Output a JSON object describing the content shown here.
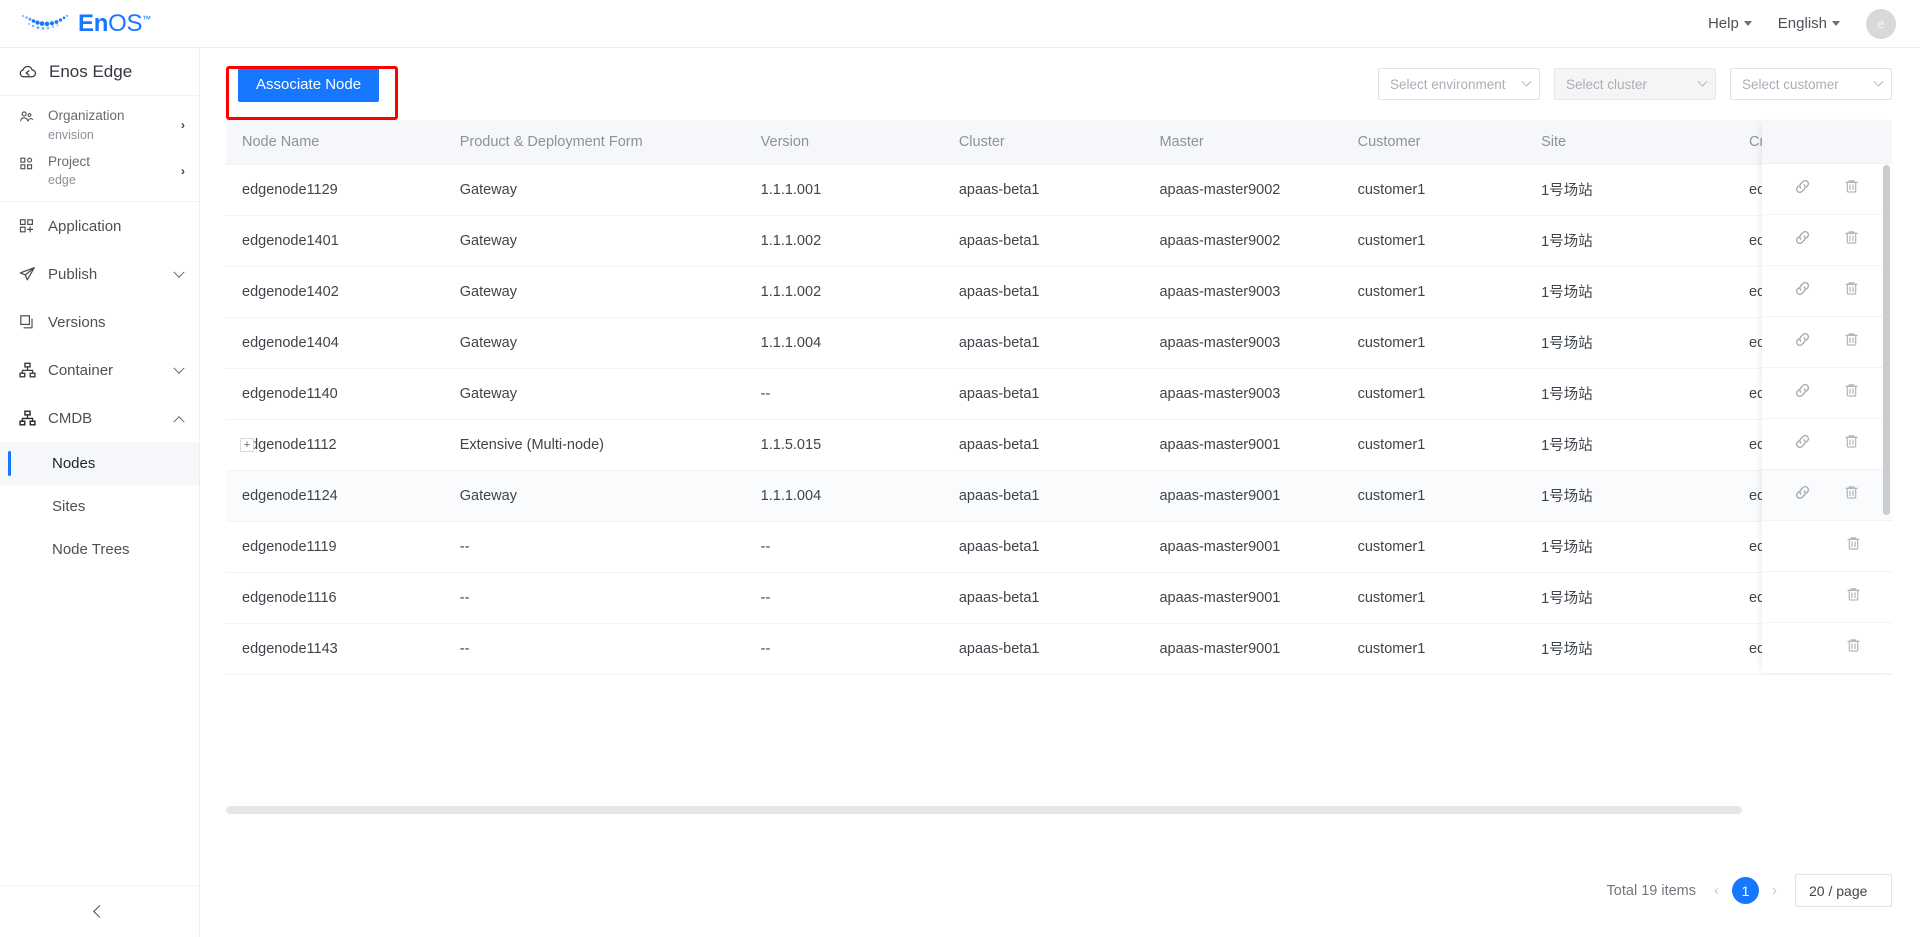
{
  "topbar": {
    "brand_en": "En",
    "brand_os": "OS",
    "brand_tm": "™",
    "help_label": "Help",
    "language_label": "English",
    "avatar_letter": "e"
  },
  "sidebar": {
    "title": "Enos Edge",
    "context": [
      {
        "label": "Organization",
        "value": "envision",
        "icon": "organization-icon"
      },
      {
        "label": "Project",
        "value": "edge",
        "icon": "project-icon"
      }
    ],
    "nav": [
      {
        "label": "Application",
        "icon": "application-icon",
        "expandable": false
      },
      {
        "label": "Publish",
        "icon": "publish-icon",
        "expandable": true,
        "expanded": false
      },
      {
        "label": "Versions",
        "icon": "versions-icon",
        "expandable": false
      },
      {
        "label": "Container",
        "icon": "container-icon",
        "expandable": true,
        "expanded": false
      },
      {
        "label": "CMDB",
        "icon": "cmdb-icon",
        "expandable": true,
        "expanded": true
      }
    ],
    "cmdb_children": [
      {
        "label": "Nodes",
        "active": true
      },
      {
        "label": "Sites",
        "active": false
      },
      {
        "label": "Node Trees",
        "active": false
      }
    ],
    "collapse_icon": "chevron-left-icon"
  },
  "toolbar": {
    "associate_node_label": "Associate Node",
    "highlight_color": "#ff0000",
    "primary_color": "#1677ff",
    "filters": [
      {
        "placeholder": "Select environment",
        "disabled": false,
        "name": "environment"
      },
      {
        "placeholder": "Select cluster",
        "disabled": true,
        "name": "cluster"
      },
      {
        "placeholder": "Select customer",
        "disabled": false,
        "name": "customer"
      }
    ]
  },
  "table": {
    "columns": [
      "Node Name",
      "Product & Deployment Form",
      "Version",
      "Cluster",
      "Master",
      "Customer",
      "Site",
      "Crea",
      ""
    ],
    "rows": [
      {
        "node": "edgenode1129",
        "product": "Gateway",
        "version": "1.1.1.001",
        "cluster": "apaas-beta1",
        "master": "apaas-master9002",
        "customer": "customer1",
        "site": "1号场站",
        "created": "edg",
        "expandable": false,
        "hovered": false,
        "actions": [
          "unlink-icon",
          "delete-icon"
        ]
      },
      {
        "node": "edgenode1401",
        "product": "Gateway",
        "version": "1.1.1.002",
        "cluster": "apaas-beta1",
        "master": "apaas-master9002",
        "customer": "customer1",
        "site": "1号场站",
        "created": "edg",
        "expandable": false,
        "hovered": false,
        "actions": [
          "unlink-icon",
          "delete-icon"
        ]
      },
      {
        "node": "edgenode1402",
        "product": "Gateway",
        "version": "1.1.1.002",
        "cluster": "apaas-beta1",
        "master": "apaas-master9003",
        "customer": "customer1",
        "site": "1号场站",
        "created": "edg",
        "expandable": false,
        "hovered": false,
        "actions": [
          "unlink-icon",
          "delete-icon"
        ]
      },
      {
        "node": "edgenode1404",
        "product": "Gateway",
        "version": "1.1.1.004",
        "cluster": "apaas-beta1",
        "master": "apaas-master9003",
        "customer": "customer1",
        "site": "1号场站",
        "created": "edg",
        "expandable": false,
        "hovered": false,
        "actions": [
          "unlink-icon",
          "delete-icon"
        ]
      },
      {
        "node": "edgenode1140",
        "product": "Gateway",
        "version": "--",
        "cluster": "apaas-beta1",
        "master": "apaas-master9003",
        "customer": "customer1",
        "site": "1号场站",
        "created": "edg",
        "expandable": false,
        "hovered": false,
        "actions": [
          "unlink-icon",
          "delete-icon"
        ]
      },
      {
        "node": "edgenode1112",
        "product": "Extensive (Multi-node)",
        "version": "1.1.5.015",
        "cluster": "apaas-beta1",
        "master": "apaas-master9001",
        "customer": "customer1",
        "site": "1号场站",
        "created": "edg",
        "expandable": true,
        "expander_label": "+",
        "hovered": false,
        "actions": [
          "unlink-icon",
          "delete-icon"
        ]
      },
      {
        "node": "edgenode1124",
        "product": "Gateway",
        "version": "1.1.1.004",
        "cluster": "apaas-beta1",
        "master": "apaas-master9001",
        "customer": "customer1",
        "site": "1号场站",
        "created": "edg",
        "expandable": false,
        "hovered": true,
        "actions": [
          "unlink-icon",
          "delete-icon"
        ]
      },
      {
        "node": "edgenode1119",
        "product": "--",
        "version": "--",
        "cluster": "apaas-beta1",
        "master": "apaas-master9001",
        "customer": "customer1",
        "site": "1号场站",
        "created": "edg",
        "expandable": false,
        "hovered": false,
        "actions": [
          "delete-icon"
        ]
      },
      {
        "node": "edgenode1116",
        "product": "--",
        "version": "--",
        "cluster": "apaas-beta1",
        "master": "apaas-master9001",
        "customer": "customer1",
        "site": "1号场站",
        "created": "edg",
        "expandable": false,
        "hovered": false,
        "actions": [
          "delete-icon"
        ]
      },
      {
        "node": "edgenode1143",
        "product": "--",
        "version": "--",
        "cluster": "apaas-beta1",
        "master": "apaas-master9001",
        "customer": "customer1",
        "site": "1号场站",
        "created": "edg",
        "expandable": false,
        "hovered": false,
        "actions": [
          "delete-icon"
        ]
      }
    ]
  },
  "pagination": {
    "total_label": "Total 19 items",
    "prev_label": "‹",
    "next_label": "›",
    "current_page": "1",
    "page_size_label": "20 / page"
  }
}
